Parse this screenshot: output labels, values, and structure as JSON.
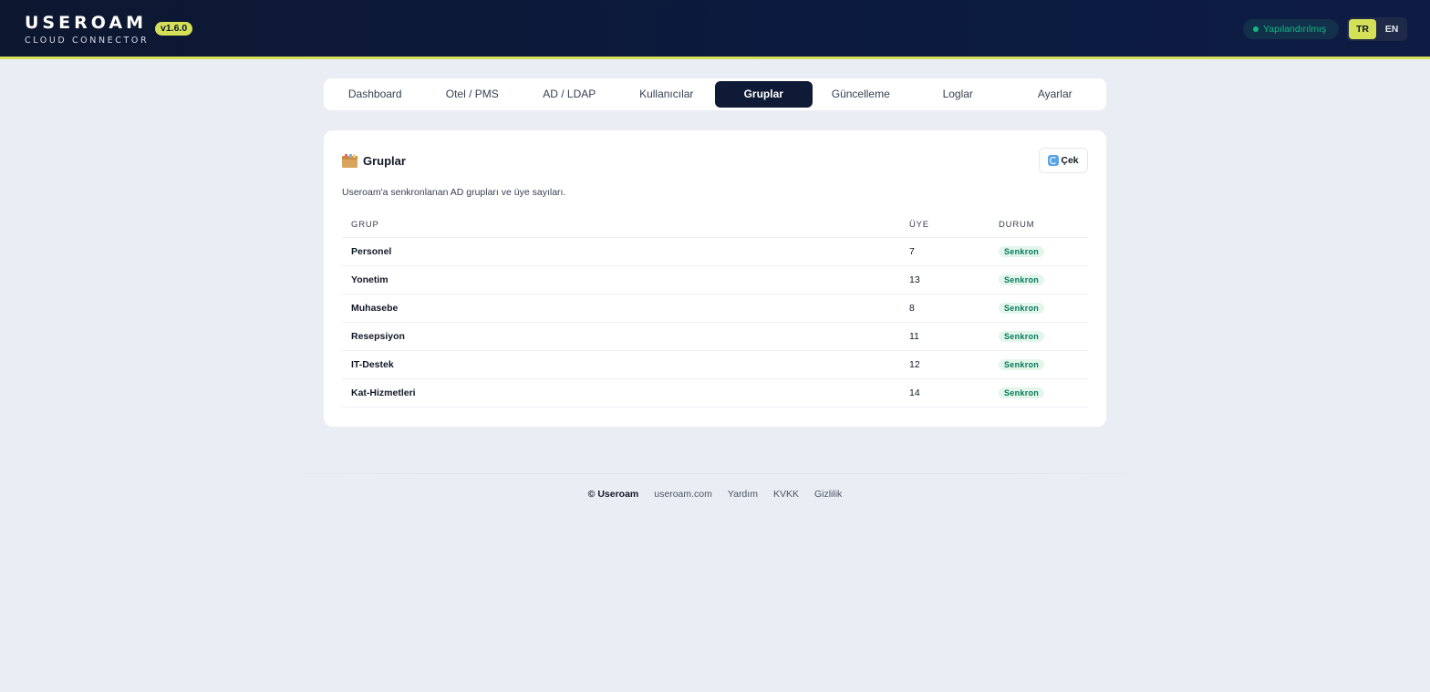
{
  "header": {
    "logo_main": "USEROAM",
    "logo_sub": "CLOUD CONNECTOR",
    "version": "v1.6.0",
    "status": "Yapılandırılmış",
    "languages": [
      {
        "label": "TR",
        "active": true
      },
      {
        "label": "EN",
        "active": false
      }
    ]
  },
  "tabs": [
    {
      "label": "Dashboard"
    },
    {
      "label": "Otel / PMS"
    },
    {
      "label": "AD / LDAP"
    },
    {
      "label": "Kullanıcılar"
    },
    {
      "label": "Gruplar",
      "active": true
    },
    {
      "label": "Güncelleme"
    },
    {
      "label": "Loglar"
    },
    {
      "label": "Ayarlar"
    }
  ],
  "card": {
    "title": "Gruplar",
    "title_icon": "folder-icon",
    "refresh_label": "Çek",
    "refresh_icon": "refresh-icon",
    "description": "Useroam'a senkronlanan AD grupları ve üye sayıları.",
    "columns": [
      "GRUP",
      "ÜYE",
      "DURUM"
    ],
    "rows": [
      {
        "group": "Personel",
        "members": "7",
        "status": "Senkron"
      },
      {
        "group": "Yonetim",
        "members": "13",
        "status": "Senkron"
      },
      {
        "group": "Muhasebe",
        "members": "8",
        "status": "Senkron"
      },
      {
        "group": "Resepsiyon",
        "members": "11",
        "status": "Senkron"
      },
      {
        "group": "IT-Destek",
        "members": "12",
        "status": "Senkron"
      },
      {
        "group": "Kat-Hizmetleri",
        "members": "14",
        "status": "Senkron"
      }
    ]
  },
  "footer": {
    "brand": "© Useroam",
    "links": [
      "useroam.com",
      "Yardım",
      "KVKK",
      "Gizlilik"
    ]
  },
  "colors": {
    "header_bg": "#0d1730",
    "accent": "#d4e157",
    "active_tab": "#0f1b36",
    "status_green": "#10b981",
    "badge_bg": "#e3f6ec",
    "badge_text": "#047857"
  }
}
